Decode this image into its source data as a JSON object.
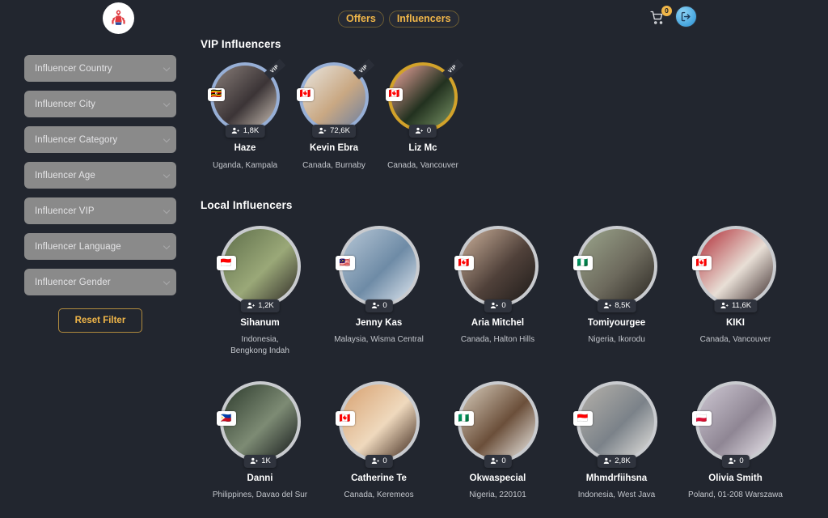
{
  "header": {
    "logo_name": "app-logo",
    "nav": [
      {
        "label": "Offers"
      },
      {
        "label": "Influencers"
      }
    ],
    "cart": {
      "icon": "shopping-cart-icon",
      "badge_count": "0"
    },
    "login": {
      "icon": "login-icon"
    }
  },
  "sidebar": {
    "filters": [
      {
        "label": "Influencer Country",
        "name": "influencer-country"
      },
      {
        "label": "Influencer City",
        "name": "influencer-city"
      },
      {
        "label": "Influencer Category",
        "name": "influencer-category"
      },
      {
        "label": "Influencer Age",
        "name": "influencer-age"
      },
      {
        "label": "Influencer VIP",
        "name": "influencer-vip"
      },
      {
        "label": "Influencer Language",
        "name": "influencer-language"
      },
      {
        "label": "Influencer Gender",
        "name": "influencer-gender"
      }
    ],
    "reset_label": "Reset Filter"
  },
  "main": {
    "vip_section_title": "VIP Influencers",
    "local_section_title": "Local Influencers",
    "vip_influencers": [
      {
        "name": "Haze",
        "location": "Uganda, Kampala",
        "followers": "1,8K",
        "flag": "🇺🇬",
        "vip_label": "VIP",
        "ring": "blue",
        "photo_colors": [
          "#8a7f7a",
          "#3b3436",
          "#cfc4b8"
        ]
      },
      {
        "name": "Kevin Ebra",
        "location": "Canada,  Burnaby",
        "followers": "72,6K",
        "flag": "🇨🇦",
        "vip_label": "VIP",
        "ring": "blue",
        "photo_colors": [
          "#e9e6e0",
          "#c9a883",
          "#6c7fa0"
        ]
      },
      {
        "name": "Liz Mc",
        "location": "Canada,  Vancouver",
        "followers": "0",
        "flag": "🇨🇦",
        "vip_label": "VIP",
        "ring": "gold",
        "photo_colors": [
          "#f0a6a0",
          "#22311f",
          "#7e9a6a"
        ]
      }
    ],
    "local_influencers_row1": [
      {
        "name": "Sihanum",
        "location": "Indonesia,\nBengkong Indah",
        "followers": "1,2K",
        "flag": "🇮🇩",
        "ring": "grey",
        "photo_colors": [
          "#5e6e4a",
          "#9aa878",
          "#2f2a26"
        ]
      },
      {
        "name": "Jenny Kas",
        "location": "Malaysia,  Wisma Central",
        "followers": "0",
        "flag": "🇲🇾",
        "ring": "grey",
        "photo_colors": [
          "#b7c7d6",
          "#6e8ba6",
          "#e3eaf2"
        ]
      },
      {
        "name": "Aria Mitchel",
        "location": "Canada,  Halton Hills",
        "followers": "0",
        "flag": "🇨🇦",
        "ring": "grey",
        "photo_colors": [
          "#cbb09a",
          "#50413a",
          "#1d1a18"
        ]
      },
      {
        "name": "Tomiyourgee",
        "location": "Nigeria,  Ikorodu",
        "followers": "8,5K",
        "flag": "🇳🇬",
        "ring": "grey",
        "photo_colors": [
          "#9ba58c",
          "#6d6a5d",
          "#2b2722"
        ]
      },
      {
        "name": "KIKI",
        "location": "Canada, Vancouver",
        "followers": "11,6K",
        "flag": "🇨🇦",
        "ring": "grey",
        "photo_colors": [
          "#b02a34",
          "#e8dfd6",
          "#3a2a2a"
        ]
      }
    ],
    "local_influencers_row2": [
      {
        "name": "Danni",
        "location": "Philippines,  Davao del Sur",
        "followers": "1K",
        "flag": "🇵🇭",
        "ring": "grey",
        "photo_colors": [
          "#2c3a2c",
          "#7d8b74",
          "#14181a"
        ]
      },
      {
        "name": "Catherine Te",
        "location": "Canada,  Keremeos",
        "followers": "0",
        "flag": "🇨🇦",
        "ring": "grey",
        "photo_colors": [
          "#d7a06f",
          "#efd9bd",
          "#3a2418"
        ]
      },
      {
        "name": "Okwaspecial",
        "location": "Nigeria,  220101",
        "followers": "0",
        "flag": "🇳🇬",
        "ring": "grey",
        "photo_colors": [
          "#d8cdbc",
          "#6b4f3a",
          "#f0efeb"
        ]
      },
      {
        "name": "Mhmdrfiihsna",
        "location": "Indonesia,  West Java",
        "followers": "2,8K",
        "flag": "🇮🇩",
        "ring": "grey",
        "photo_colors": [
          "#b6b2ab",
          "#7b8289",
          "#e8e6e2"
        ]
      },
      {
        "name": "Olivia Smith",
        "location": "Poland,  01-208 Warszawa",
        "followers": "0",
        "flag": "🇵🇱",
        "ring": "grey",
        "photo_colors": [
          "#cfc9d4",
          "#8f8694",
          "#ece8ee"
        ]
      }
    ]
  },
  "colors": {
    "background": "#22262f",
    "accent_gold": "#f0b649",
    "filter_field": "#8a8a8a",
    "badge_dark": "#2f333d",
    "ring_blue": "#97afd6",
    "ring_gold": "#d2a22a",
    "ring_grey": "#c9cbcf"
  }
}
